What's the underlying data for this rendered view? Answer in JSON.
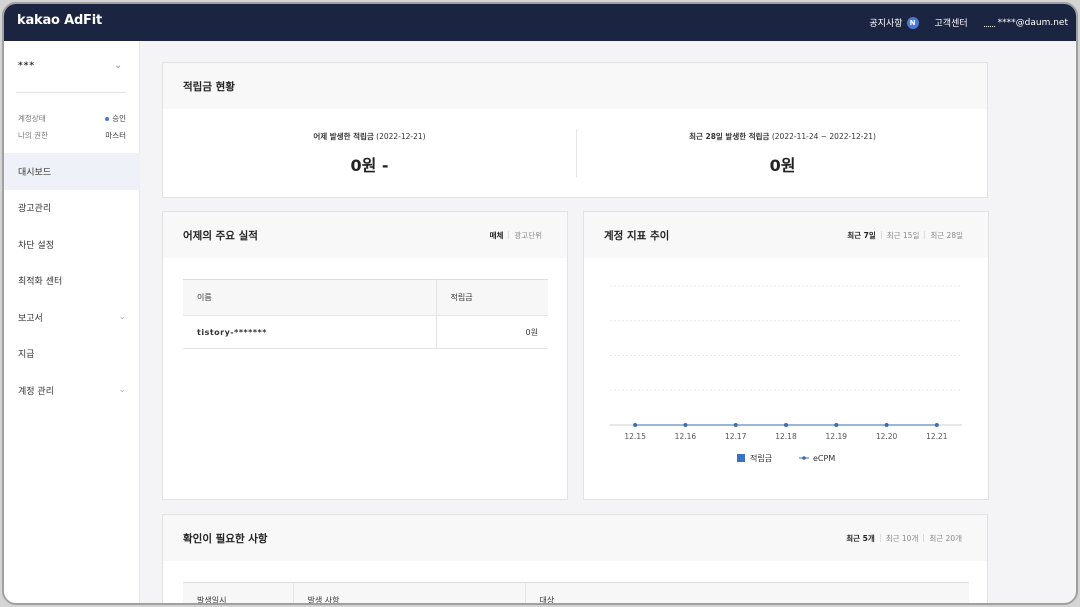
{
  "topbar": {
    "logo": "kakao AdFit",
    "notice_label": "공지사항",
    "notice_badge": "N",
    "support_label": "고객센터",
    "user_email": "****@daum.net",
    "colors": {
      "background": "#1b2440",
      "badge": "#4a78d8"
    }
  },
  "sidebar": {
    "account_name": "***",
    "status_label": "계정상태",
    "status_value": "승인",
    "role_label": "나의 권한",
    "role_value": "마스터",
    "menu": [
      {
        "label": "대시보드",
        "active": true,
        "has_chevron": false
      },
      {
        "label": "광고관리",
        "active": false,
        "has_chevron": false
      },
      {
        "label": "차단 설정",
        "active": false,
        "has_chevron": false
      },
      {
        "label": "최적화 센터",
        "active": false,
        "has_chevron": false
      },
      {
        "label": "보고서",
        "active": false,
        "has_chevron": true
      },
      {
        "label": "지급",
        "active": false,
        "has_chevron": false
      },
      {
        "label": "계정 관리",
        "active": false,
        "has_chevron": true
      }
    ]
  },
  "earnings": {
    "title": "적립금 현황",
    "yesterday_label": "어제 발생한 적립금",
    "yesterday_period": "(2022-12-21)",
    "yesterday_value": "0원 -",
    "recent_label": "최근 28일 발생한 적립금",
    "recent_period": "(2022-11-24 ~ 2022-12-21)",
    "recent_value": "0원"
  },
  "performance": {
    "title": "어제의 주요 실적",
    "tabs": [
      "매체",
      "광고단위"
    ],
    "active_tab": "매체",
    "columns": [
      "이름",
      "적립금"
    ],
    "rows": [
      {
        "name": "tistory-*******",
        "earnings": "0원"
      }
    ]
  },
  "trend": {
    "title": "계정 지표 추이",
    "tabs": [
      "최근 7일",
      "최근 15일",
      "최근 28일"
    ],
    "active_tab": "최근 7일"
  },
  "chart_data": {
    "type": "line",
    "x": [
      "12.15",
      "12.16",
      "12.17",
      "12.18",
      "12.19",
      "12.20",
      "12.21"
    ],
    "series": [
      {
        "name": "적립금",
        "kind": "bar",
        "values": [
          0,
          0,
          0,
          0,
          0,
          0,
          0
        ],
        "color": "#3d6fc4"
      },
      {
        "name": "eCPM",
        "kind": "line",
        "values": [
          0,
          0,
          0,
          0,
          0,
          0,
          0
        ],
        "color": "#3a6fa8"
      }
    ],
    "grid": true,
    "legend": "bottom"
  },
  "action_items": {
    "title": "확인이 필요한 사항",
    "tabs": [
      "최근 5개",
      "최근 10개",
      "최근 20개"
    ],
    "active_tab": "최근 5개",
    "columns": [
      "발생일시",
      "발생 사항",
      "대상"
    ]
  }
}
